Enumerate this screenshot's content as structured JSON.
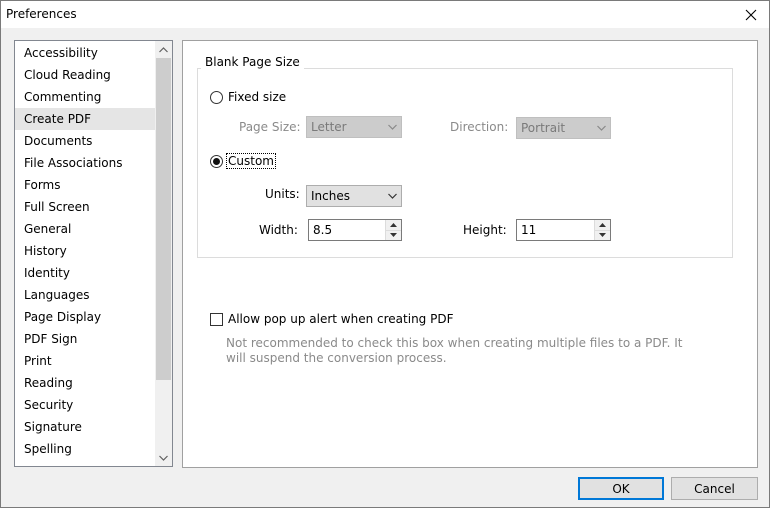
{
  "window": {
    "title": "Preferences"
  },
  "sidebar": {
    "items": [
      {
        "label": "Accessibility"
      },
      {
        "label": "Cloud Reading"
      },
      {
        "label": "Commenting"
      },
      {
        "label": "Create PDF",
        "selected": true
      },
      {
        "label": "Documents"
      },
      {
        "label": "File Associations"
      },
      {
        "label": "Forms"
      },
      {
        "label": "Full Screen"
      },
      {
        "label": "General"
      },
      {
        "label": "History"
      },
      {
        "label": "Identity"
      },
      {
        "label": "Languages"
      },
      {
        "label": "Page Display"
      },
      {
        "label": "PDF Sign"
      },
      {
        "label": "Print"
      },
      {
        "label": "Reading"
      },
      {
        "label": "Security"
      },
      {
        "label": "Signature"
      },
      {
        "label": "Spelling"
      }
    ]
  },
  "blank_page": {
    "group_title": "Blank Page Size",
    "fixed_size_label": "Fixed size",
    "page_size_label": "Page Size:",
    "page_size_value": "Letter",
    "direction_label": "Direction:",
    "direction_value": "Portrait",
    "custom_label": "Custom",
    "units_label": "Units:",
    "units_value": "Inches",
    "width_label": "Width:",
    "width_value": "8.5",
    "height_label": "Height:",
    "height_value": "11",
    "selected_option": "Custom"
  },
  "popup_alert": {
    "label": "Allow pop up alert when creating PDF",
    "checked": false,
    "note": "Not recommended to check this box when creating multiple files to a PDF. It will suspend the conversion process."
  },
  "buttons": {
    "ok": "OK",
    "cancel": "Cancel"
  },
  "colors": {
    "accent": "#0078d7",
    "selected_bg": "#e5e5e5",
    "disabled_text": "#8a8a8a"
  }
}
